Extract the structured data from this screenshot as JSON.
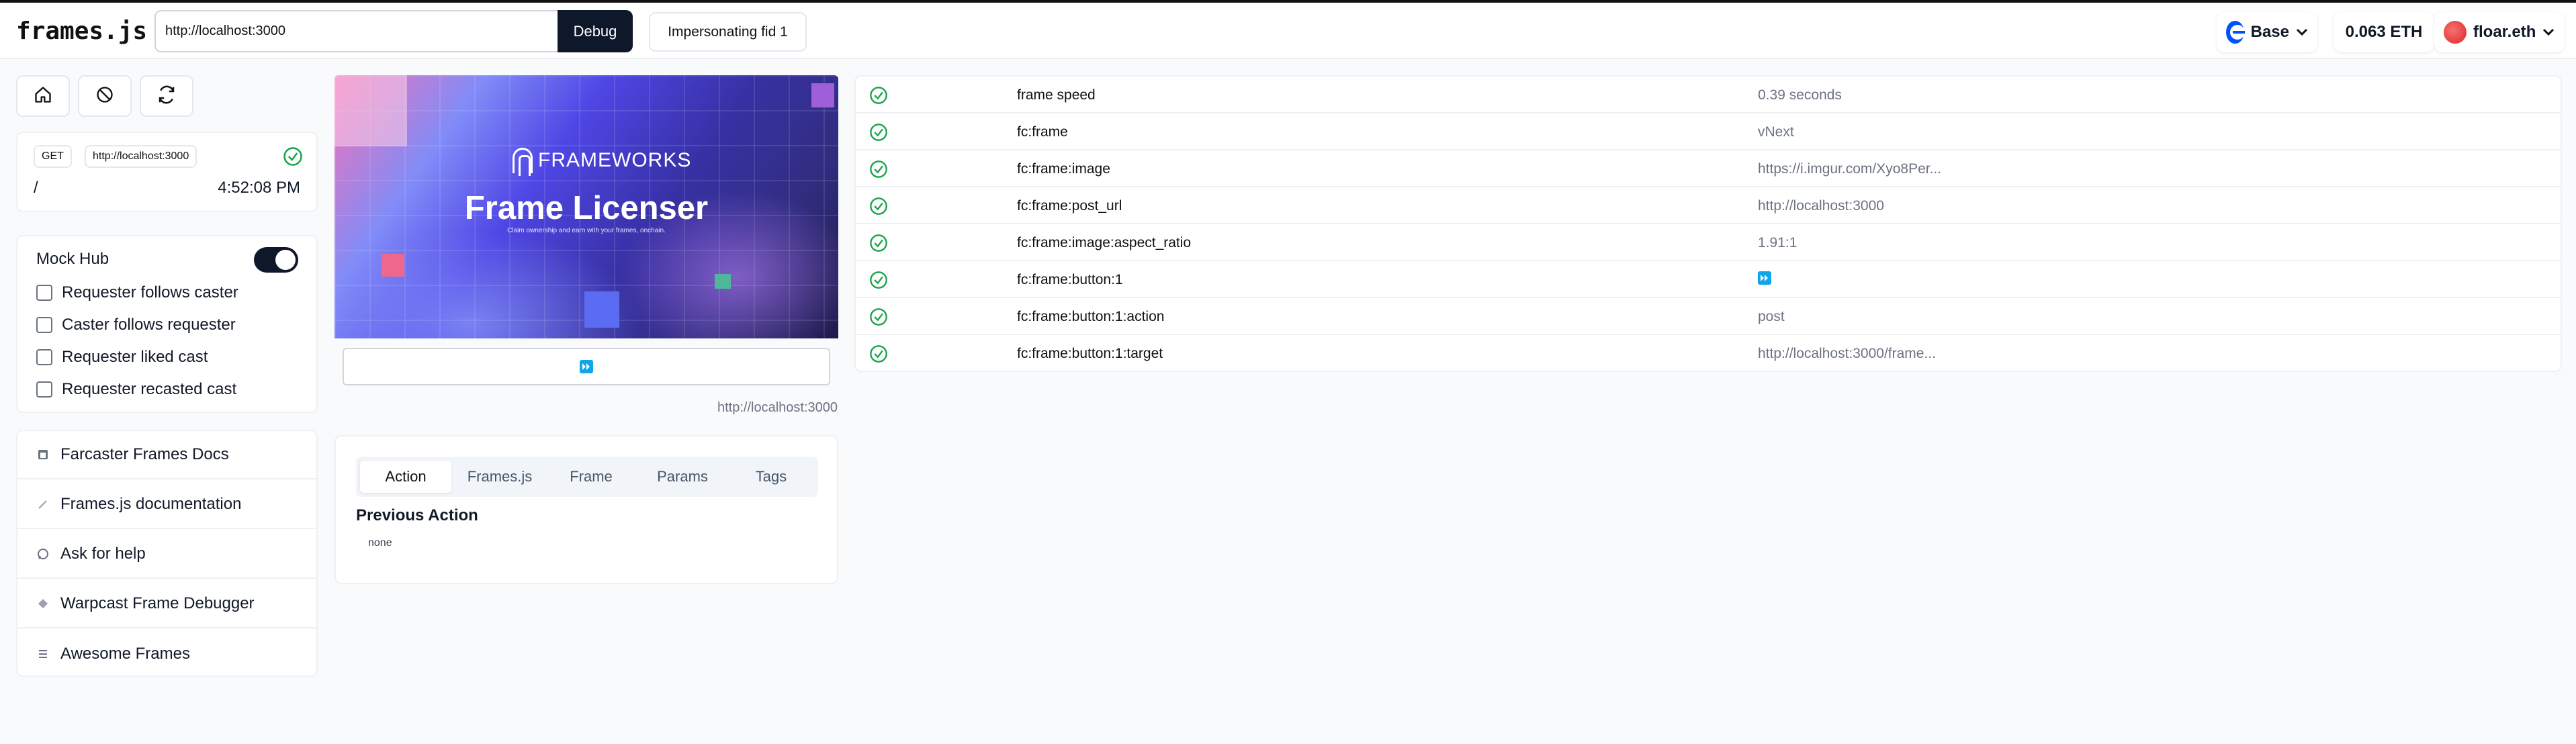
{
  "app": {
    "logo": "frames.js"
  },
  "header": {
    "url_value": "http://localhost:3000",
    "debug_label": "Debug",
    "impersonating_label": "Impersonating fid 1",
    "network_label": "Base",
    "balance_label": "0.063 ETH",
    "user_label": "floar.eth"
  },
  "toolbar": {
    "icons": [
      "home-icon",
      "ban-icon",
      "refresh-icon"
    ]
  },
  "request": {
    "method": "GET",
    "url": "http://localhost:3000",
    "path": "/",
    "time": "4:52:08 PM"
  },
  "mock_hub": {
    "title": "Mock Hub",
    "enabled": true,
    "options": [
      {
        "label": "Requester follows caster",
        "checked": false
      },
      {
        "label": "Caster follows requester",
        "checked": false
      },
      {
        "label": "Requester liked cast",
        "checked": false
      },
      {
        "label": "Requester recasted cast",
        "checked": false
      }
    ]
  },
  "links": [
    {
      "label": "Farcaster Frames Docs",
      "icon": "farcaster-icon"
    },
    {
      "label": "Frames.js documentation",
      "icon": "pencil-icon"
    },
    {
      "label": "Ask for help",
      "icon": "chat-icon"
    },
    {
      "label": "Warpcast Frame Debugger",
      "icon": "diamond-icon"
    },
    {
      "label": "Awesome Frames",
      "icon": "list-icon"
    }
  ],
  "frame": {
    "brand": "FRAMEWORKS",
    "title": "Frame Licenser",
    "subtitle": "Claim ownership and earn with your frames, onchain.",
    "button_icon": "fast-forward-icon",
    "url": "http://localhost:3000"
  },
  "tabs": {
    "items": [
      "Action",
      "Frames.js",
      "Frame",
      "Params",
      "Tags"
    ],
    "active": "Action",
    "section_title": "Previous Action",
    "section_value": "none"
  },
  "props": [
    {
      "key": "frame speed",
      "value": "0.39 seconds"
    },
    {
      "key": "fc:frame",
      "value": "vNext"
    },
    {
      "key": "fc:frame:image",
      "value": "https://i.imgur.com/Xyo8Per..."
    },
    {
      "key": "fc:frame:post_url",
      "value": "http://localhost:3000"
    },
    {
      "key": "fc:frame:image:aspect_ratio",
      "value": "1.91:1"
    },
    {
      "key": "fc:frame:button:1",
      "value": ""
    },
    {
      "key": "fc:frame:button:1:action",
      "value": "post"
    },
    {
      "key": "fc:frame:button:1:target",
      "value": "http://localhost:3000/frame..."
    }
  ],
  "colors": {
    "ok": "#16a34a",
    "dark": "#0f172a",
    "accent_blue": "#0052ff",
    "fastforward": "#0ea5e9"
  }
}
